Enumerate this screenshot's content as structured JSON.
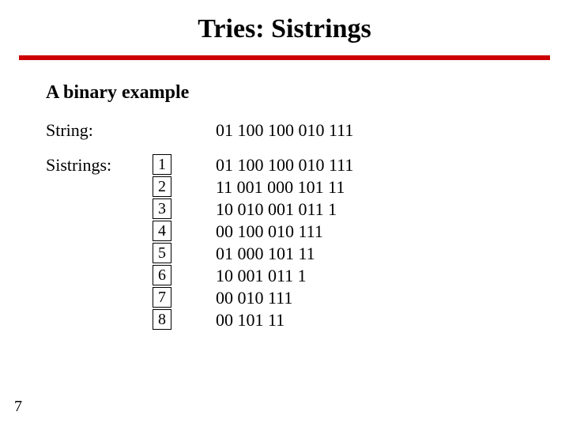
{
  "title": "Tries: Sistrings",
  "subtitle": "A binary example",
  "labels": {
    "string": "String:",
    "sistrings": "Sistrings:"
  },
  "string_value": "01 100 100 010 111",
  "sistrings": [
    {
      "idx": "1",
      "value": "01 100 100 010 111"
    },
    {
      "idx": "2",
      "value": "11 001 000 101 11"
    },
    {
      "idx": "3",
      "value": "10 010 001 011 1"
    },
    {
      "idx": "4",
      "value": "00 100 010 111"
    },
    {
      "idx": "5",
      "value": "01 000 101 11"
    },
    {
      "idx": "6",
      "value": "10 001 011 1"
    },
    {
      "idx": "7",
      "value": "00 010 111"
    },
    {
      "idx": "8",
      "value": "00 101 11"
    }
  ],
  "page_number": "7"
}
